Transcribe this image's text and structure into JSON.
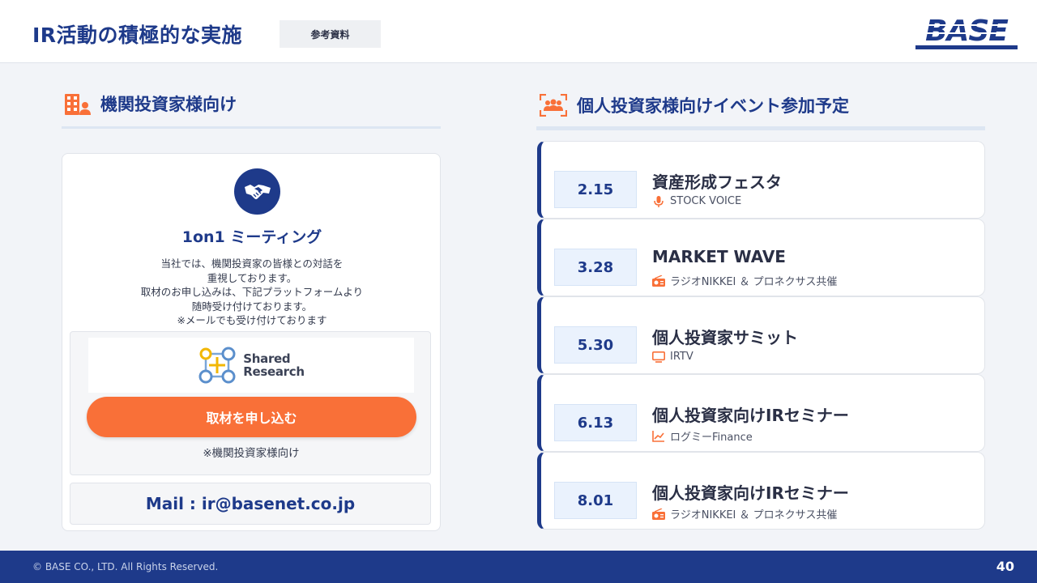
{
  "header": {
    "title": "IR活動の積極的な実施",
    "badge": "参考資料",
    "logo_text": "BASE"
  },
  "left": {
    "section_title": "機関投資家様向け",
    "card": {
      "title": "1on1 ミーティング",
      "desc": [
        "当社では、機関投資家の皆様との対話を",
        "重視しております。",
        "取材のお申し込みは、下記プラットフォームより",
        "随時受け付けております。",
        "※メールでも受け付けております"
      ],
      "platform_logo": [
        "Shared",
        "Research"
      ],
      "button_label": "取材を申し込む",
      "note": "※機関投資家様向け",
      "mail": "Mail : ir@basenet.co.jp"
    }
  },
  "right": {
    "section_title": "個人投資家様向けイベント参加予定",
    "events": [
      {
        "date": "2.15",
        "title": "資産形成フェスタ",
        "org": "STOCK VOICE",
        "icon": "microphone-icon"
      },
      {
        "date": "3.28",
        "title": "MARKET WAVE",
        "org": "ラジオNIKKEI ＆ プロネクサス共催",
        "icon": "radio-icon"
      },
      {
        "date": "5.30",
        "title": "個人投資家サミット",
        "org": "IRTV",
        "icon": "tv-icon"
      },
      {
        "date": "6.13",
        "title": "個人投資家向けIRセミナー",
        "org": "ログミーFinance",
        "icon": "chart-line-icon"
      },
      {
        "date": "8.01",
        "title": "個人投資家向けIRセミナー",
        "org": "ラジオNIKKEI ＆ プロネクサス共催",
        "icon": "radio-icon"
      }
    ]
  },
  "footer": {
    "copyright": "© BASE CO., LTD. All Rights Reserved.",
    "page_number": "40"
  },
  "colors": {
    "navy": "#1e3a8a",
    "orange": "#f97038",
    "date_bg": "#eaf2fd"
  }
}
